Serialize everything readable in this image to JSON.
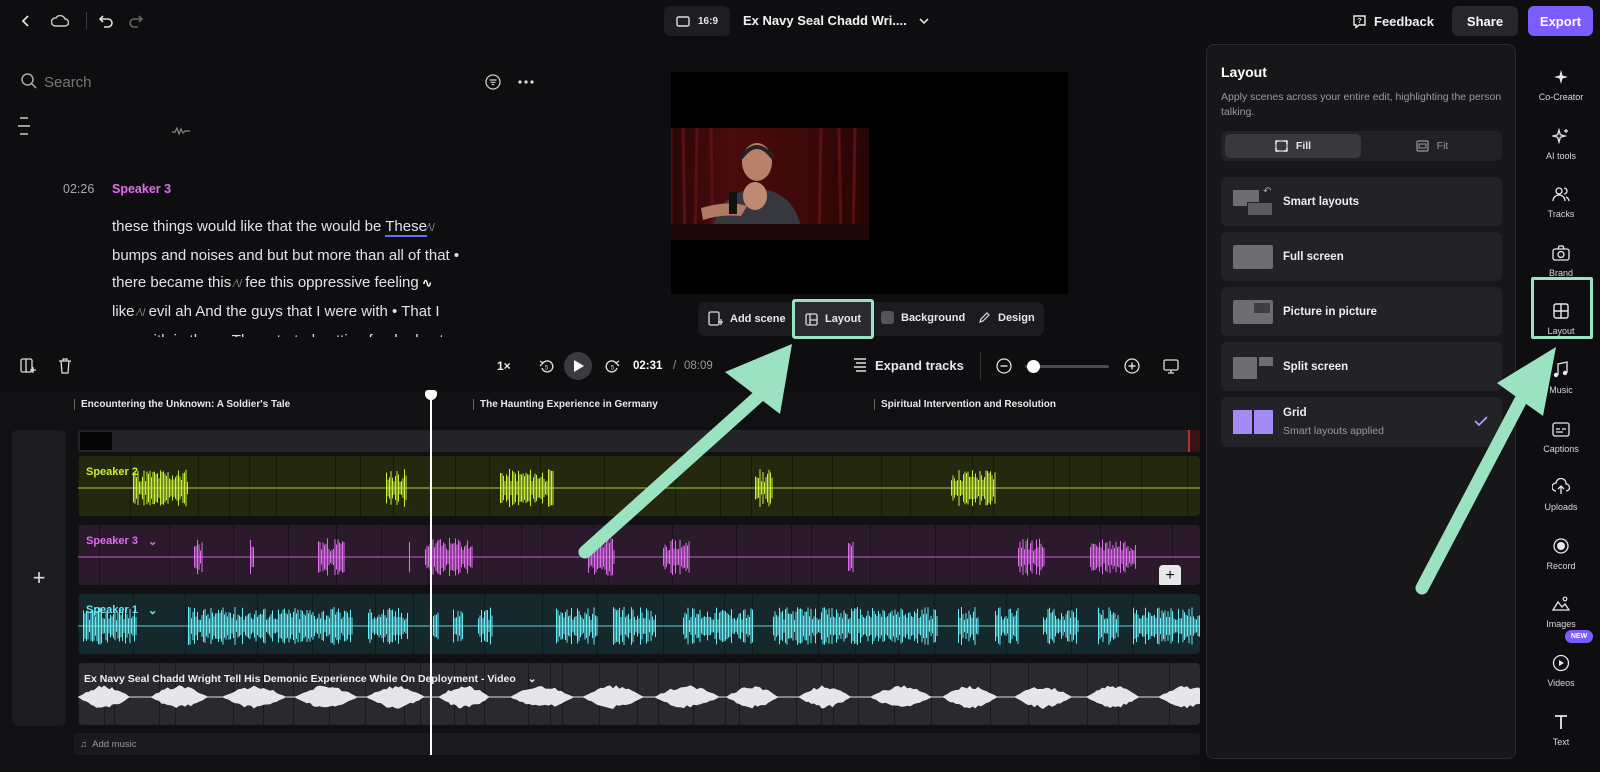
{
  "topbar": {
    "aspect_ratio": "16:9",
    "project_title": "Ex Navy Seal Chadd Wri....",
    "feedback_label": "Feedback",
    "share_label": "Share",
    "export_label": "Export"
  },
  "colors": {
    "accent": "#7a5cff",
    "speaker2": "#c8ef3a",
    "speaker3": "#e26cf0",
    "speaker1": "#69ecf5",
    "highlight": "#9be3c0"
  },
  "transcript": {
    "search_placeholder": "Search",
    "timestamp": "02:26",
    "speaker": "Speaker 3",
    "lines": [
      "these things would like that the would be",
      "bumps and noises and but but more than all of that •",
      "there became this",
      "like",
      "was with in there. They started getting freaked out"
    ],
    "line1_word": "These",
    "line3_tail": "fee this oppressive feeling",
    "line4_tail": "evil ah And the guys that I were with • That I"
  },
  "scene_toolbar": {
    "add_scene": "Add scene",
    "layout": "Layout",
    "background": "Background",
    "design": "Design"
  },
  "playback": {
    "speed": "1×",
    "current_time": "02:31",
    "separator": "/",
    "total_time": "08:09",
    "expand_tracks": "Expand tracks",
    "zoom_level": 0.1
  },
  "timeline": {
    "chapters": [
      "Encountering the Unknown: A Soldier's Tale",
      "The Haunting Experience in Germany",
      "Spiritual Intervention and Resolution"
    ],
    "tracks": {
      "speaker2": "Speaker 2",
      "speaker3": "Speaker 3",
      "speaker1": "Speaker 1",
      "video": "Ex Navy Seal Chadd Wright Tell His Demonic Experience While On Deployment - Video"
    },
    "add_music": "Add music"
  },
  "layout_panel": {
    "title": "Layout",
    "description": "Apply scenes across your entire edit, highlighting the person talking.",
    "fill_label": "Fill",
    "fit_label": "Fit",
    "options": [
      {
        "label": "Smart layouts",
        "sub": ""
      },
      {
        "label": "Full screen",
        "sub": ""
      },
      {
        "label": "Picture in picture",
        "sub": ""
      },
      {
        "label": "Split screen",
        "sub": ""
      },
      {
        "label": "Grid",
        "sub": "Smart layouts applied"
      }
    ]
  },
  "rail": {
    "items": [
      "Co-Creator",
      "AI tools",
      "Tracks",
      "Brand",
      "Layout",
      "Music",
      "Captions",
      "Uploads",
      "Record",
      "Images",
      "Videos",
      "Text"
    ],
    "new_badge": "NEW"
  }
}
